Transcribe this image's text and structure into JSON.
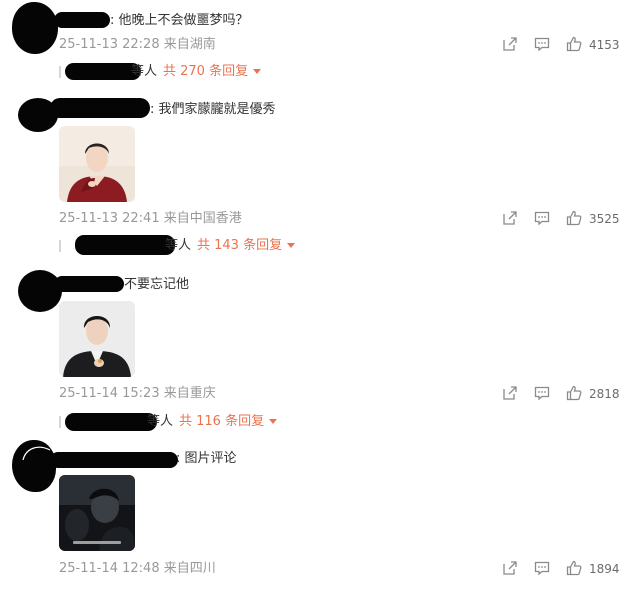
{
  "comments": [
    {
      "text": "他晚上不会做噩梦吗？",
      "meta": "25-11-13 22:28 来自湖南",
      "likes": "4153",
      "reply_tail": "等人",
      "reply_count": "共 270 条回复",
      "has_image": false
    },
    {
      "text": "我們家朦朧就是優秀",
      "meta": "25-11-13 22:41 来自中国香港",
      "likes": "3525",
      "reply_tail": "等人",
      "reply_count": "共 143 条回复",
      "has_image": true
    },
    {
      "text": "不要忘记他",
      "meta": "25-11-14 15:23 来自重庆",
      "likes": "2818",
      "reply_tail": "等人",
      "reply_count": "共 116 条回复",
      "has_image": true
    },
    {
      "text": "图片评论",
      "meta": "25-11-14 12:48 来自四川",
      "likes": "1894",
      "has_image": true
    }
  ],
  "icons": {
    "share": "share-icon",
    "comment": "comment-icon",
    "like": "thumbs-up-icon",
    "expand": "caret-down-icon"
  },
  "colors": {
    "reply_accent": "#eb7350",
    "meta_gray": "#999999",
    "redaction": "#050505"
  }
}
